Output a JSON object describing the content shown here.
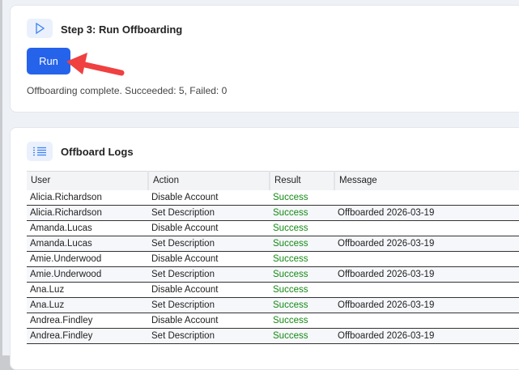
{
  "step": {
    "title": "Step 3: Run Offboarding",
    "run_label": "Run",
    "status": "Offboarding complete. Succeeded: 5, Failed: 0"
  },
  "logs": {
    "title": "Offboard Logs",
    "columns": [
      "User",
      "Action",
      "Result",
      "Message"
    ],
    "rows": [
      [
        "Alicia.Richardson",
        "Disable Account",
        "Success",
        ""
      ],
      [
        "Alicia.Richardson",
        "Set Description",
        "Success",
        "Offboarded 2026-03-19"
      ],
      [
        "Amanda.Lucas",
        "Disable Account",
        "Success",
        ""
      ],
      [
        "Amanda.Lucas",
        "Set Description",
        "Success",
        "Offboarded 2026-03-19"
      ],
      [
        "Amie.Underwood",
        "Disable Account",
        "Success",
        ""
      ],
      [
        "Amie.Underwood",
        "Set Description",
        "Success",
        "Offboarded 2026-03-19"
      ],
      [
        "Ana.Luz",
        "Disable Account",
        "Success",
        ""
      ],
      [
        "Ana.Luz",
        "Set Description",
        "Success",
        "Offboarded 2026-03-19"
      ],
      [
        "Andrea.Findley",
        "Disable Account",
        "Success",
        ""
      ],
      [
        "Andrea.Findley",
        "Set Description",
        "Success",
        "Offboarded 2026-03-19"
      ]
    ]
  },
  "colors": {
    "accent": "#2563eb",
    "success": "#138a13",
    "annotation": "#f04040"
  }
}
